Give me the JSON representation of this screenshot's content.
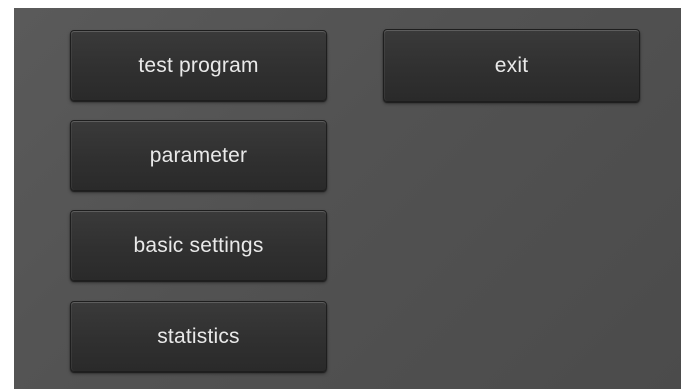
{
  "menu": {
    "test_program_label": "test program",
    "parameter_label": "parameter",
    "basic_settings_label": "basic settings",
    "statistics_label": "statistics",
    "exit_label": "exit"
  },
  "colors": {
    "background": "#545454",
    "button": "#323232",
    "text": "#e9e9e9"
  }
}
